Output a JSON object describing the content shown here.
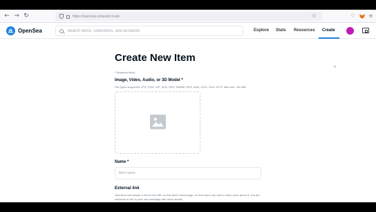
{
  "browser": {
    "url": "https://opensea.io/asset/create",
    "back_icon": "arrow-left-icon",
    "forward_icon": "arrow-right-icon",
    "reload_icon": "reload-icon",
    "shield_icon": "shield-icon",
    "bookmark_icon": "star-icon",
    "extensions": [
      "pocket-icon",
      "metamask-fox-icon",
      "menu-icon"
    ]
  },
  "header": {
    "brand": "OpenSea",
    "brand_color": "#2081e2",
    "search_placeholder": "Search items, collections, and accounts",
    "nav": [
      "Explore",
      "Stats",
      "Resources",
      "Create"
    ],
    "active_nav": "Create",
    "avatar_color": "#c01ab4"
  },
  "form": {
    "title": "Create New Item",
    "required_note": "* Required fields",
    "media_label": "Image, Video, Audio, or 3D Model *",
    "media_types": "File types supported: JPG, PNG, GIF, SVG, MP4, WEBM, MP3, WAV, OGG, GLB, GLTF. Max size: 100 MB",
    "media_icon": "image-icon",
    "name_label": "Name *",
    "name_placeholder": "Item name",
    "name_value": "",
    "external_link_label": "External link",
    "external_link_help": "OpenSea will include a link to this URL on this item's detail page, so that users can click to learn more about it. You are welcome to link to your own webpage with more details."
  }
}
